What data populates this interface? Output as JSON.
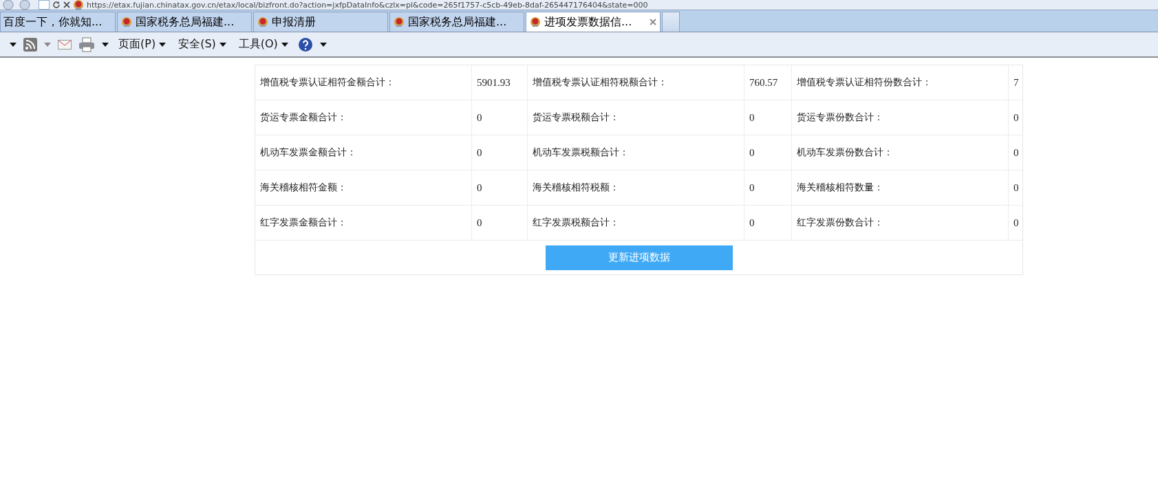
{
  "address_bar": {
    "url": "https://etax.fujian.chinatax.gov.cn/etax/local/bizfront.do?action=jxfpDataInfo&czlx=pl&code=265f1757-c5cb-49eb-8daf-265447176404&state=000"
  },
  "tabs": [
    {
      "label": "百度一下，你就知...",
      "selected": false,
      "kind": "plain"
    },
    {
      "label": "国家税务总局福建...",
      "selected": false,
      "kind": "emblem"
    },
    {
      "label": "申报清册",
      "selected": false,
      "kind": "emblem"
    },
    {
      "label": "国家税务总局福建...",
      "selected": false,
      "kind": "emblem"
    },
    {
      "label": "进项发票数据信...",
      "selected": true,
      "kind": "emblem"
    }
  ],
  "toolbar": {
    "menus": [
      "页面(P)",
      "安全(S)",
      "工具(O)"
    ]
  },
  "table": {
    "rows": [
      {
        "cells": [
          {
            "label": "增值税专票认证相符金额合计：",
            "value": "5901.93"
          },
          {
            "label": "增值税专票认证相符税额合计：",
            "value": "760.57"
          },
          {
            "label": "增值税专票认证相符份数合计：",
            "value": "7"
          }
        ]
      },
      {
        "cells": [
          {
            "label": "货运专票金额合计：",
            "value": "0"
          },
          {
            "label": "货运专票税额合计：",
            "value": "0"
          },
          {
            "label": "货运专票份数合计：",
            "value": "0"
          }
        ]
      },
      {
        "cells": [
          {
            "label": "机动车发票金额合计：",
            "value": "0"
          },
          {
            "label": "机动车发票税额合计：",
            "value": "0"
          },
          {
            "label": "机动车发票份数合计：",
            "value": "0"
          }
        ]
      },
      {
        "cells": [
          {
            "label": "海关稽核相符金额：",
            "value": "0"
          },
          {
            "label": "海关稽核相符税额：",
            "value": "0"
          },
          {
            "label": "海关稽核相符数量：",
            "value": "0"
          }
        ]
      },
      {
        "cells": [
          {
            "label": "红字发票金额合计：",
            "value": "0"
          },
          {
            "label": "红字发票税额合计：",
            "value": "0"
          },
          {
            "label": "红字发票份数合计：",
            "value": "0"
          }
        ]
      }
    ],
    "button": "更新进项数据"
  }
}
